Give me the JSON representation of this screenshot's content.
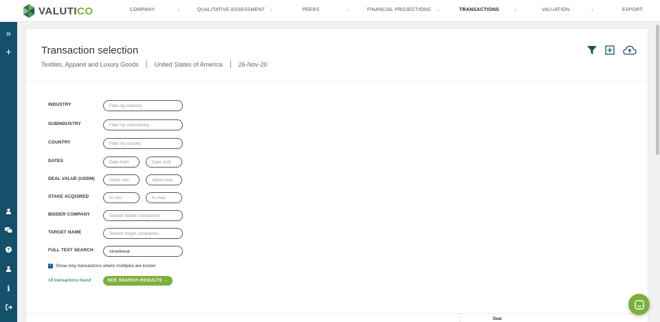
{
  "brand": {
    "name_part1": "VALUTI",
    "name_part2": "CO",
    "accent": "#7ab03c",
    "primary": "#15506a"
  },
  "nav": {
    "steps": [
      {
        "label": "COMPANY",
        "active": false
      },
      {
        "label": "QUALITATIVE ASSESSMENT",
        "active": false
      },
      {
        "label": "PEERS",
        "active": false
      },
      {
        "label": "FINANCIAL PROJECTIONS",
        "active": false
      },
      {
        "label": "TRANSACTIONS",
        "active": true
      },
      {
        "label": "VALUATION",
        "active": false
      },
      {
        "label": "EXPORT",
        "active": false
      }
    ],
    "separator": "›"
  },
  "sidebar": {
    "top_icons": [
      "expand-icon",
      "plus-icon"
    ],
    "bottom_icons": [
      "user-icon",
      "chat-icon",
      "help-icon",
      "account-icon",
      "info-icon",
      "logout-icon"
    ]
  },
  "page": {
    "title": "Transaction selection",
    "industry": "Textiles, Apparel and Luxury Goods",
    "country": "United States of America",
    "date": "26-Nov-20",
    "actions": [
      "filter-icon",
      "add-icon",
      "cloud-upload-icon"
    ]
  },
  "form": {
    "industry": {
      "label": "INDUSTRY",
      "placeholder": "Filter by industry",
      "value": ""
    },
    "subindustry": {
      "label": "SUBINDUSTRY",
      "placeholder": "Filter by subindustry",
      "value": ""
    },
    "country": {
      "label": "COUNTRY",
      "placeholder": "Filter by country",
      "value": ""
    },
    "dates": {
      "label": "DATES",
      "from_placeholder": "Date from",
      "until_placeholder": "Date until"
    },
    "deal_value": {
      "label": "DEAL VALUE (USDM)",
      "min_placeholder": "Value min",
      "max_placeholder": "Value max"
    },
    "stake": {
      "label": "STAKE ACQUIRED",
      "min_placeholder": "% min",
      "max_placeholder": "% max"
    },
    "bidder": {
      "label": "BIDDER COMPANY",
      "placeholder": "Search bidder companies",
      "value": ""
    },
    "target": {
      "label": "TARGET NAME",
      "placeholder": "Search target companies",
      "value": ""
    },
    "fulltext": {
      "label": "FULL TEXT SEARCH",
      "placeholder": "",
      "value": "streetwear"
    },
    "multiples_checkbox": {
      "label": "Show only transactions where multiples are known",
      "checked": true
    },
    "results_found": "18 transactions found",
    "see_results_button": "SEE SEARCH RESULTS →"
  },
  "table": {
    "header_partial": "Deal"
  }
}
